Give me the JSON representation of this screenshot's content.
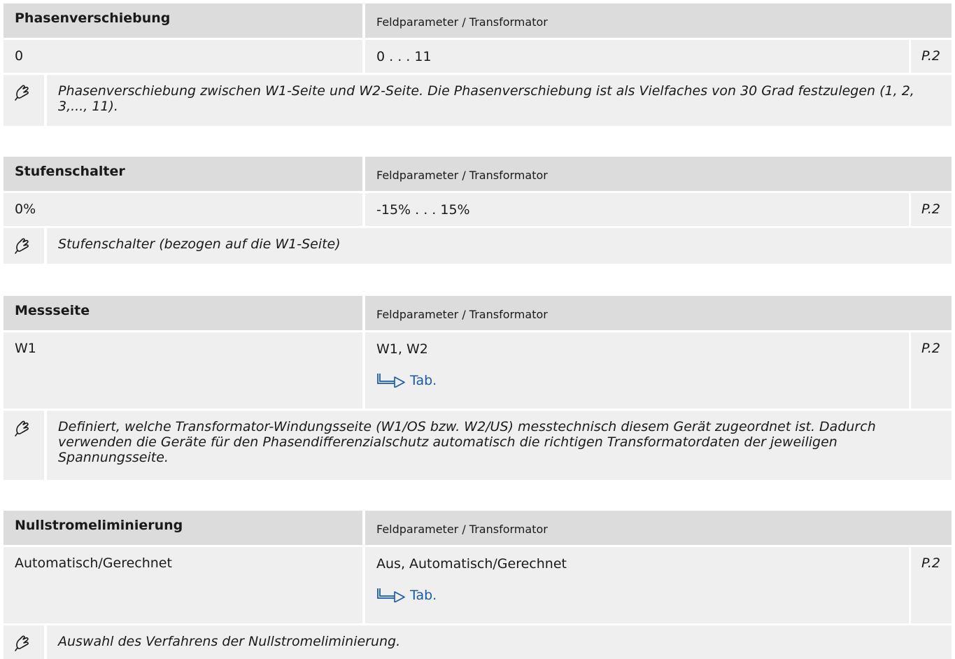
{
  "params": [
    {
      "name": "Phasenverschiebung",
      "path": "Feldparameter / Transformator",
      "default": "0",
      "range": "0 . . . 11",
      "access": "P.2",
      "tab": "",
      "description": "Phasenverschiebung zwischen W1-Seite und W2-Seite. Die Phasenverschiebung ist als Vielfaches von 30 Grad festzulegen (1, 2, 3,..., 11)."
    },
    {
      "name": "Stufenschalter",
      "path": "Feldparameter / Transformator",
      "default": "0%",
      "range": "-15% . . . 15%",
      "access": "P.2",
      "tab": "",
      "description": "Stufenschalter (bezogen auf die W1-Seite)"
    },
    {
      "name": "Messseite",
      "path": "Feldparameter / Transformator",
      "default": "W1",
      "range": "W1, W2",
      "access": "P.2",
      "tab": "Tab.",
      "description": "Definiert, welche Transformator-Windungsseite (W1/OS bzw. W2/US) messtechnisch diesem Gerät zugeordnet ist. Dadurch verwenden die Geräte für den Phasendifferenzialschutz automatisch die richtigen Transformatordaten der jeweiligen Spannungsseite."
    },
    {
      "name": "Nullstromeliminierung",
      "path": "Feldparameter / Transformator",
      "default": "Automatisch/Gerechnet",
      "range": "Aus, Automatisch/Gerechnet",
      "access": "P.2",
      "tab": "Tab.",
      "description": "Auswahl des Verfahrens der Nullstromeliminierung."
    }
  ],
  "icons": {
    "setting": "wrench-hand-icon",
    "tab_link": "table-arrow-icon"
  },
  "colors": {
    "header_bg": "#dcdcdc",
    "row_bg": "#efefef",
    "link": "#1a5aa8"
  }
}
